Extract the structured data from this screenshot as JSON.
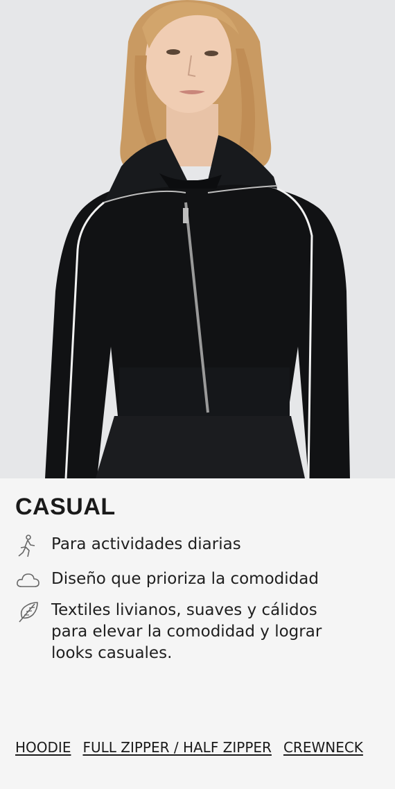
{
  "hero": {
    "image": "woman-wearing-black-cropped-zip-jacket"
  },
  "panel": {
    "title": "CASUAL",
    "features": [
      {
        "icon": "walking-person-icon",
        "text": "Para actividades diarias"
      },
      {
        "icon": "cloud-icon",
        "text": "Diseño que prioriza la comodidad"
      },
      {
        "icon": "feather-icon",
        "text": "Textiles livianos, suaves y cálidos para elevar la comodidad y lograr looks casuales."
      }
    ],
    "links": [
      {
        "label": "HOODIE"
      },
      {
        "label": "FULL ZIPPER / HALF ZIPPER"
      },
      {
        "label": "CREWNECK"
      }
    ]
  }
}
